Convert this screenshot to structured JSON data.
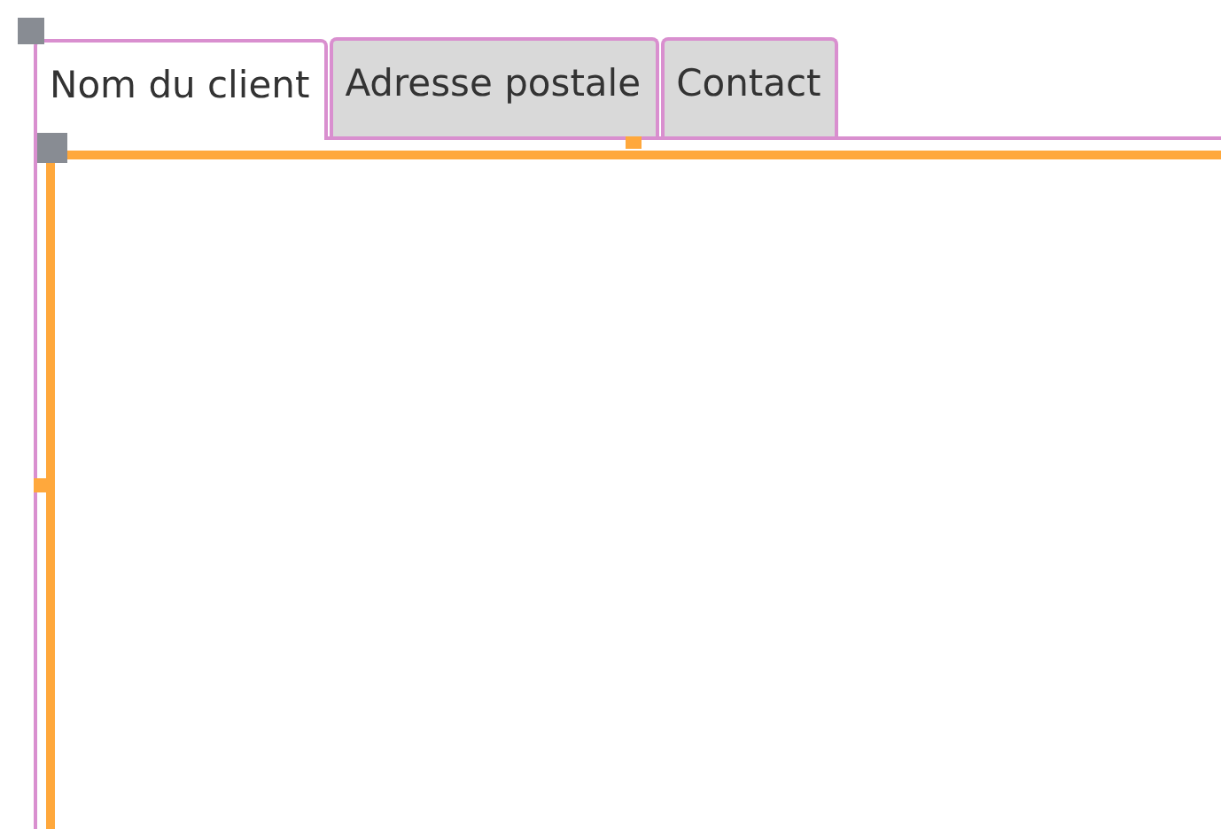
{
  "tabs": [
    {
      "label": "Nom du client",
      "selected": true
    },
    {
      "label": "Adresse postale",
      "selected": false
    },
    {
      "label": "Contact",
      "selected": false
    }
  ]
}
